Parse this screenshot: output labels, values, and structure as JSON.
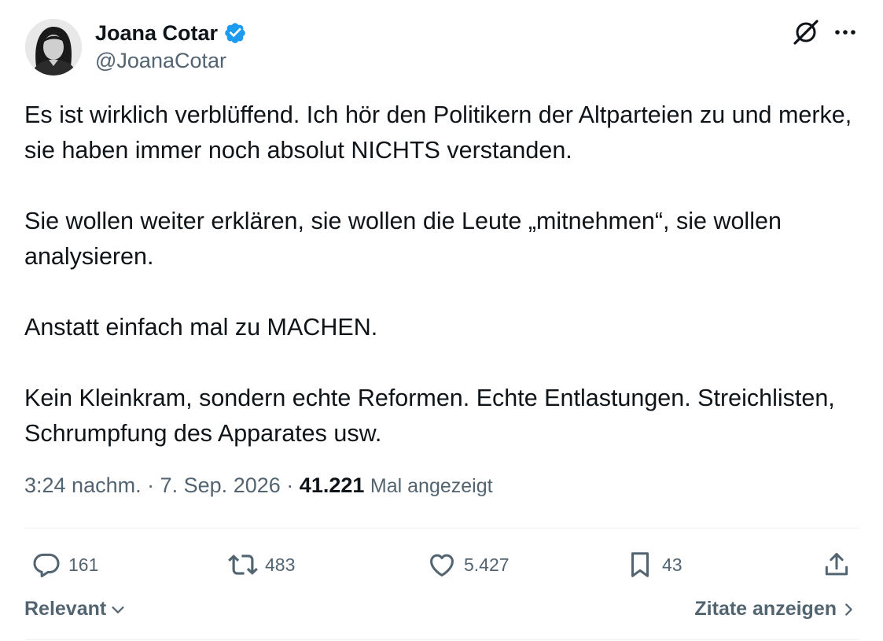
{
  "author": {
    "name": "Joana Cotar",
    "handle": "@JoanaCotar",
    "verified_color": "#1d9bf0"
  },
  "tweet": {
    "paragraphs": [
      "Es ist wirklich verblüffend. Ich hör den Politikern der Altparteien zu und merke, sie haben immer noch absolut NICHTS verstanden.",
      "Sie wollen weiter erklären, sie wollen die Leute „mitnehmen“, sie wollen analysieren.",
      "Anstatt einfach mal zu MACHEN.",
      "Kein Kleinkram, sondern echte Reformen. Echte Entlastungen. Streichlisten, Schrumpfung des Apparates usw."
    ],
    "time": "3:24 nachm.",
    "separator": "·",
    "date": "7. Sep. 2026",
    "views_count": "41.221",
    "views_label": "Mal angezeigt"
  },
  "actions": {
    "replies": "161",
    "reposts": "483",
    "likes": "5.427",
    "bookmarks": "43"
  },
  "footer": {
    "sort_label": "Relevant",
    "quotes_label": "Zitate anzeigen"
  },
  "icons": [
    "grok-icon",
    "more-icon",
    "verified-badge-icon",
    "reply-icon",
    "repost-icon",
    "like-icon",
    "bookmark-icon",
    "share-icon",
    "chevron-down-icon",
    "chevron-right-icon"
  ]
}
